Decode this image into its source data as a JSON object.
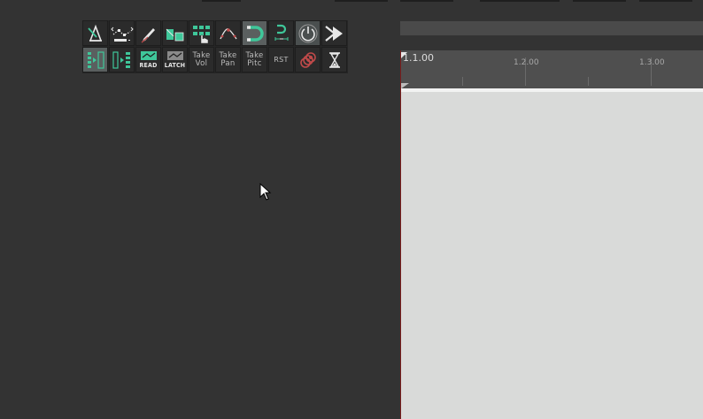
{
  "toolbar": {
    "row1": [
      {
        "name": "metronome",
        "icon": "metronome-icon"
      },
      {
        "name": "ripple-editing",
        "icon": "envelope-points-icon"
      },
      {
        "name": "pencil",
        "icon": "pencil-icon"
      },
      {
        "name": "item-grouping",
        "icon": "item-grouping-icon"
      },
      {
        "name": "grid-snap",
        "icon": "grid-hand-icon"
      },
      {
        "name": "envelope-lock",
        "icon": "envelope-curve-icon"
      },
      {
        "name": "snap",
        "icon": "magnet-icon",
        "active": true
      },
      {
        "name": "snap-settings",
        "icon": "magnet-bracket-icon"
      },
      {
        "name": "power",
        "icon": "power-icon",
        "active": true
      },
      {
        "name": "fast-forward",
        "icon": "fast-forward-icon"
      }
    ],
    "row2": {
      "read_label": "READ",
      "latch_label": "LATCH",
      "take_vol": [
        "Take",
        "Vol"
      ],
      "take_pan": [
        "Take",
        "Pan"
      ],
      "take_pitch": [
        "Take",
        "Pitc"
      ],
      "rst_label": "RST"
    }
  },
  "ruler": {
    "labels": [
      "1.1.00",
      "1.2.00",
      "1.3.00"
    ]
  },
  "colors": {
    "accent_green": "#3fc79a",
    "track_bg": "#d9dad9",
    "ruler_bg": "#4f4f4f",
    "panel_bg": "#333333",
    "playhead": "#7a1d1d"
  }
}
